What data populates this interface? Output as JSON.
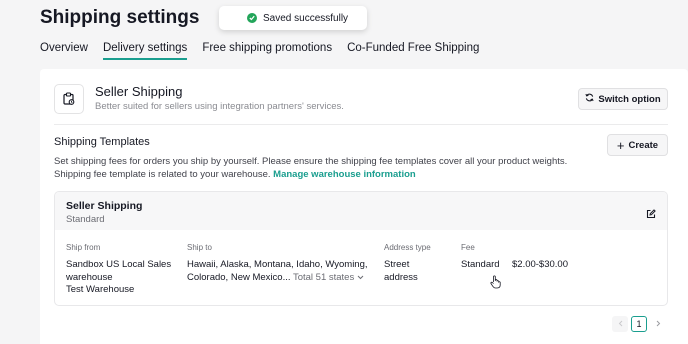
{
  "page": {
    "title": "Shipping settings"
  },
  "toast": {
    "text": "Saved successfully",
    "icon": "check-circle-icon",
    "color": "#23a55a"
  },
  "tabs": [
    {
      "label": "Overview"
    },
    {
      "label": "Delivery settings",
      "active": true
    },
    {
      "label": "Free shipping promotions"
    },
    {
      "label": "Co-Funded Free Shipping"
    }
  ],
  "seller": {
    "title": "Seller Shipping",
    "description": "Better suited for sellers using integration partners' services.",
    "switch_label": "Switch option"
  },
  "templates": {
    "title": "Shipping Templates",
    "create_label": "Create",
    "info_line1": "Set shipping fees for orders you ship by yourself. Please ensure the shipping fee templates cover all your product weights.",
    "info_line2": "Shipping fee template is related to your warehouse.",
    "manage_link": "Manage warehouse information"
  },
  "template_card": {
    "name": "Seller Shipping",
    "type": "Standard",
    "columns": {
      "ship_from": "Ship from",
      "ship_to": "Ship to",
      "address_type": "Address type",
      "fee": "Fee"
    },
    "row": {
      "ship_from_line1": "Sandbox US Local Sales",
      "ship_from_line2": "warehouse",
      "ship_from_line3": "Test Warehouse",
      "ship_to_line1": "Hawaii, Alaska, Montana, Idaho, Wyoming,",
      "ship_to_line2": "Colorado, New Mexico...",
      "ship_to_total": "Total 51 states",
      "address_type_line1": "Street",
      "address_type_line2": "address",
      "fee_type": "Standard",
      "fee_range": "$2.00-$30.00"
    }
  },
  "pagination": {
    "current": "1"
  },
  "colors": {
    "accent": "#1a9e8f",
    "background": "#f5f5f6"
  }
}
